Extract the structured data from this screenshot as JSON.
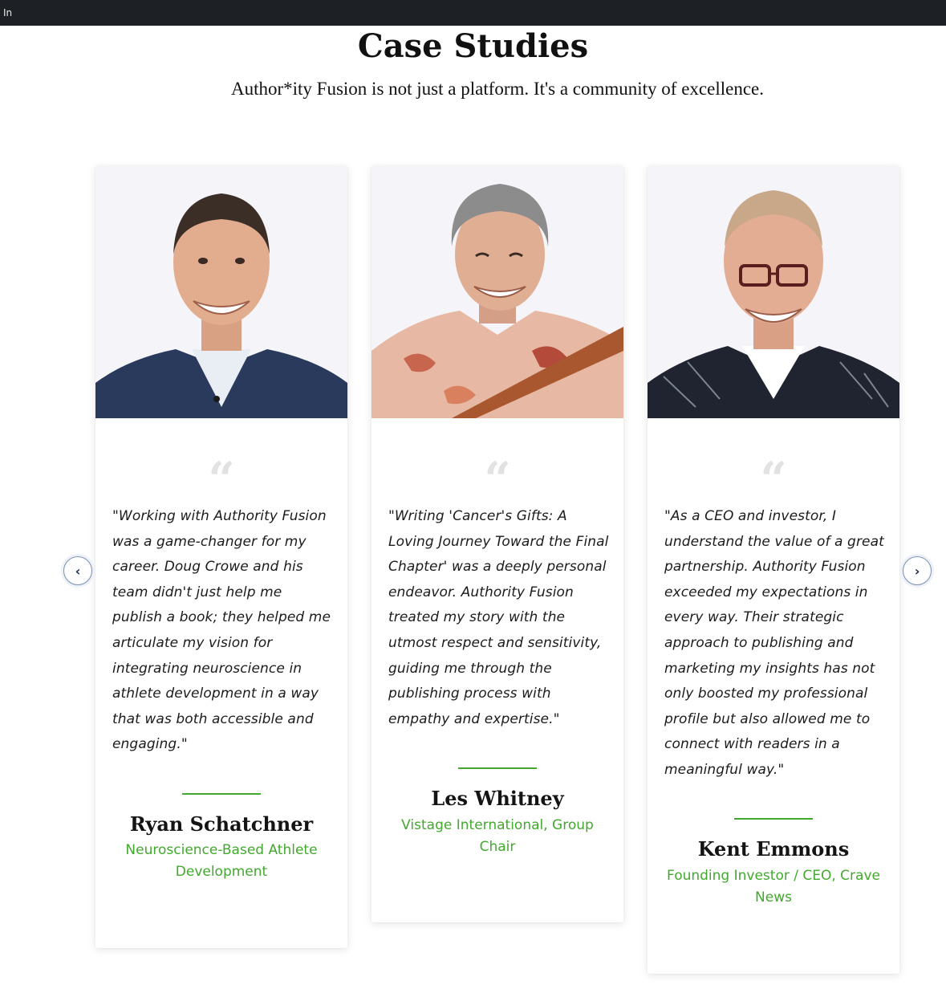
{
  "browser": {
    "tab_label": "In"
  },
  "section": {
    "title": "Case Studies",
    "subtitle": "Author*ity Fusion is not just a platform. It's a community of excellence."
  },
  "carousel": {
    "prev_icon": "chevron-left-icon",
    "next_icon": "chevron-right-icon",
    "prev_glyph": "‹",
    "next_glyph": "›",
    "quote_glyph": "“",
    "accent_color": "#43a82f",
    "cards": [
      {
        "photo": "portrait-ryan-schatchner",
        "quote": "\"Working with Authority Fusion was a game-changer for my career. Doug Crowe and his team didn't just help me publish a book; they helped me articulate my vision for integrating neuroscience in athlete development in a way that was both accessible and engaging.\"",
        "name": "Ryan Schatchner",
        "role": "Neuroscience-Based Athlete Development"
      },
      {
        "photo": "portrait-les-whitney",
        "quote": "\"Writing 'Cancer's Gifts: A Loving Journey Toward the Final Chapter' was a deeply personal endeavor. Authority Fusion treated my story with the utmost respect and sensitivity, guiding me through the publishing process with empathy and expertise.\"",
        "name": "Les Whitney",
        "role": "Vistage International, Group Chair"
      },
      {
        "photo": "portrait-kent-emmons",
        "quote": "\"As a CEO and investor, I understand the value of a great partnership. Authority Fusion exceeded my expectations in every way. Their strategic approach to publishing and marketing my insights has not only boosted my professional profile but also allowed me to connect with readers in a meaningful way.\"",
        "name": "Kent Emmons",
        "role": "Founding Investor / CEO, Crave News"
      }
    ]
  }
}
